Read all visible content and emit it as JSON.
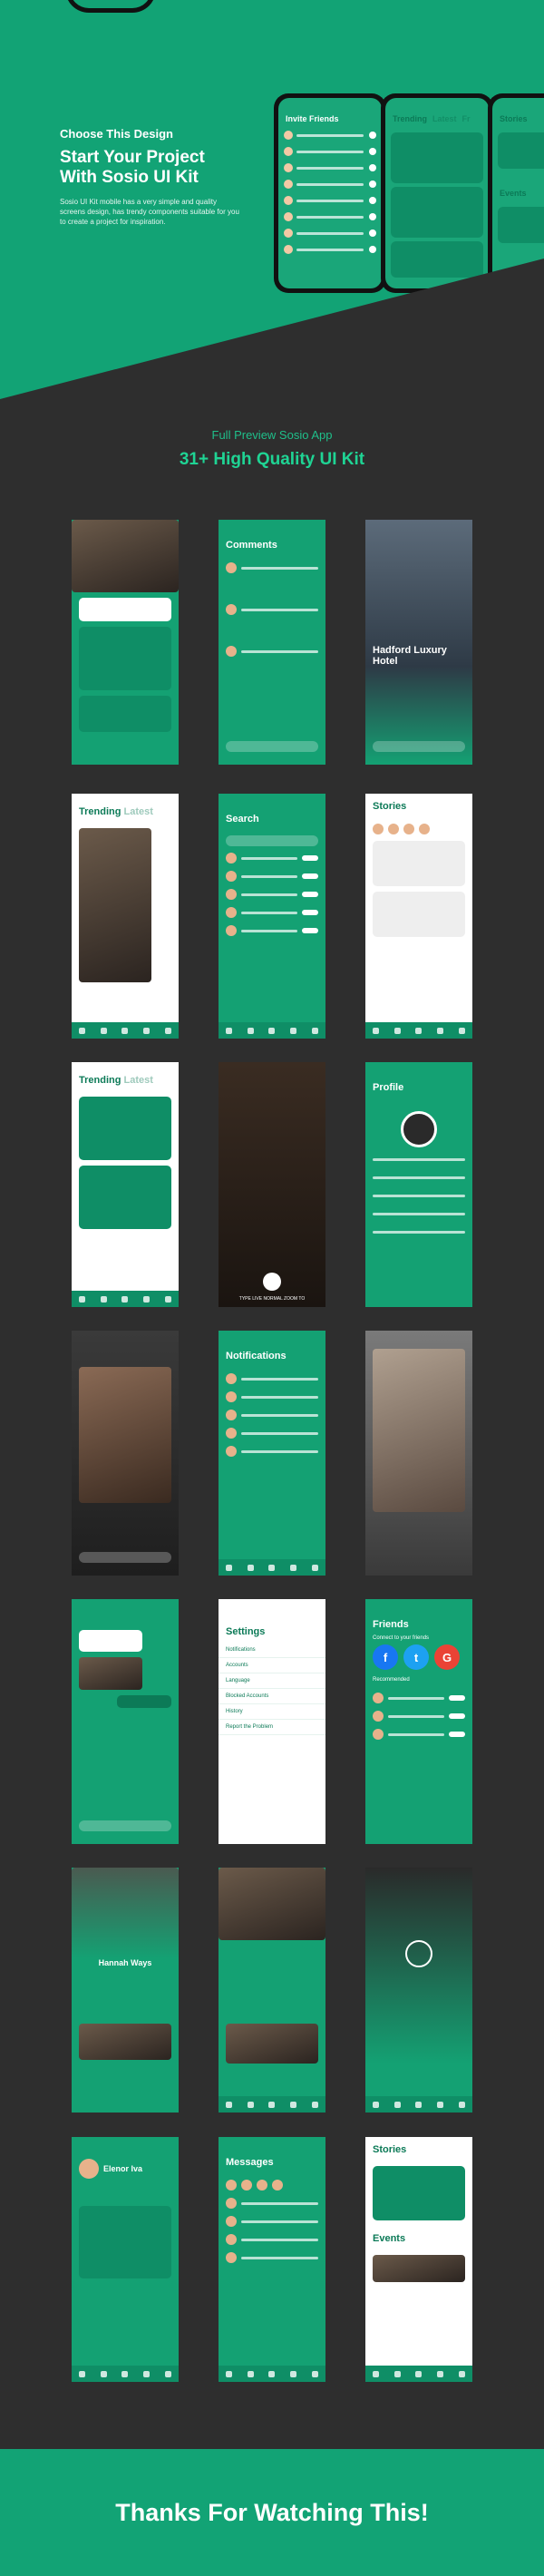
{
  "hero": {
    "kicker": "Choose This Design",
    "title_line1": "Start Your Project",
    "title_line2": "With Sosio UI Kit",
    "description": "Sosio UI Kit mobile has a very simple and quality screens design, has trendy components suitable for you to create a project for inspiration."
  },
  "hero_phones": [
    {
      "title": "Invite Friends"
    },
    {
      "tabs": [
        "Trending",
        "Latest",
        "Fr"
      ]
    },
    {
      "title": "Stories",
      "events": "Events"
    }
  ],
  "section": {
    "subtitle": "Full Preview Sosio App",
    "title": "31+ High Quality UI Kit"
  },
  "screens": {
    "comments": "Comments",
    "trending": "Trending",
    "latest": "Latest",
    "search": "Search",
    "stories": "Stories",
    "profile": "Profile",
    "notifications": "Notifications",
    "settings": "Settings",
    "friends": "Friends",
    "messages": "Messages",
    "hotel": "Hadford Luxury Hotel",
    "user_name": "Hannah Ways",
    "profile_name": "Elenor Iva",
    "connect": "Connect to your friends",
    "recommended": "Recommended",
    "settings_items": [
      "Notifications",
      "Accounts",
      "Language",
      "Blocked Accounts",
      "History",
      "Report the Problem"
    ],
    "social": [
      "f",
      "t",
      "G"
    ],
    "camera_modes": "TYPE  LIVE  NORMAL  ZOOM  TO"
  },
  "footer": {
    "text": "Thanks For Watching This!"
  },
  "colors": {
    "primary": "#12a375",
    "dark_bg": "#2e2e2e",
    "accent_text": "#1fd494"
  }
}
